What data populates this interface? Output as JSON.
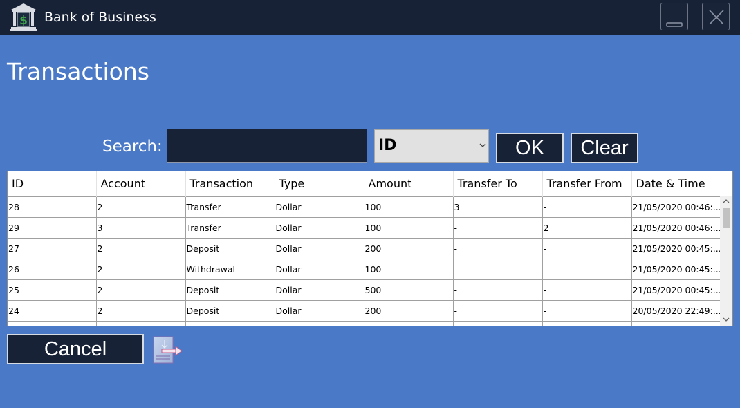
{
  "app": {
    "title": "Bank of Business",
    "logo_icon": "bank-dollar-icon"
  },
  "window_controls": {
    "minimize_icon": "minimize-icon",
    "close_icon": "close-icon"
  },
  "page": {
    "title": "Transactions"
  },
  "search": {
    "label": "Search:",
    "value": "",
    "placeholder": "",
    "field_selected": "ID",
    "ok_label": "OK",
    "clear_label": "Clear"
  },
  "table": {
    "columns": [
      "ID",
      "Account",
      "Transaction",
      "Type",
      "Amount",
      "Transfer To",
      "Transfer From",
      "Date & Time"
    ],
    "rows": [
      [
        "28",
        "2",
        "Transfer",
        "Dollar",
        "100",
        "3",
        "-",
        "21/05/2020 00:46:..."
      ],
      [
        "29",
        "3",
        "Transfer",
        "Dollar",
        "100",
        "-",
        "2",
        "21/05/2020 00:46:..."
      ],
      [
        "27",
        "2",
        "Deposit",
        "Dollar",
        "200",
        "-",
        "-",
        "21/05/2020 00:45:..."
      ],
      [
        "26",
        "2",
        "Withdrawal",
        "Dollar",
        "100",
        "-",
        "-",
        "21/05/2020 00:45:..."
      ],
      [
        "25",
        "2",
        "Deposit",
        "Dollar",
        "500",
        "-",
        "-",
        "21/05/2020 00:45:..."
      ],
      [
        "24",
        "2",
        "Deposit",
        "Dollar",
        "200",
        "-",
        "-",
        "20/05/2020 22:49:..."
      ],
      [
        "",
        "",
        "",
        "",
        "",
        "",
        "",
        ""
      ]
    ]
  },
  "footer": {
    "cancel_label": "Cancel",
    "export_icon": "export-icon"
  },
  "colors": {
    "background": "#4a79c7",
    "titlebar": "#172237",
    "button": "#172237"
  }
}
